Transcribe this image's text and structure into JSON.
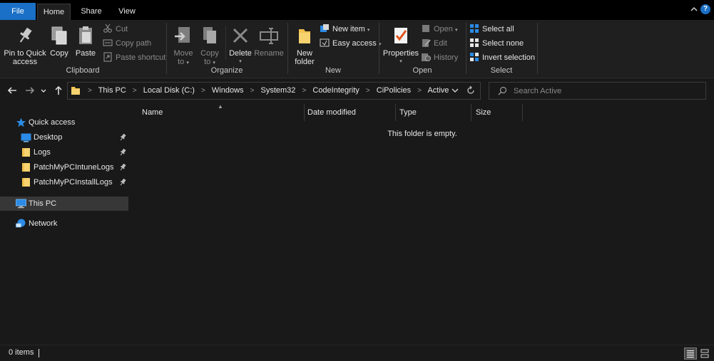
{
  "tabs": [
    {
      "label": "File"
    },
    {
      "label": "Home"
    },
    {
      "label": "Share"
    },
    {
      "label": "View"
    }
  ],
  "ribbon": {
    "clipboard": {
      "label": "Clipboard",
      "pin_line1": "Pin to Quick",
      "pin_line2": "access",
      "copy": "Copy",
      "paste": "Paste",
      "cut": "Cut",
      "copy_path": "Copy path",
      "paste_shortcut": "Paste shortcut"
    },
    "organize": {
      "label": "Organize",
      "move_line1": "Move",
      "move_line2": "to",
      "copy_line1": "Copy",
      "copy_line2": "to",
      "delete": "Delete",
      "rename": "Rename"
    },
    "new": {
      "label": "New",
      "folder_line1": "New",
      "folder_line2": "folder",
      "new_item": "New item",
      "easy_access": "Easy access"
    },
    "open": {
      "label": "Open",
      "properties": "Properties",
      "open": "Open",
      "edit": "Edit",
      "history": "History"
    },
    "select": {
      "label": "Select",
      "select_all": "Select all",
      "select_none": "Select none",
      "invert": "Invert selection"
    }
  },
  "address": {
    "crumbs": [
      "This PC",
      "Local Disk (C:)",
      "Windows",
      "System32",
      "CodeIntegrity",
      "CiPolicies",
      "Active"
    ]
  },
  "search": {
    "placeholder": "Search Active"
  },
  "nav": {
    "quick_access": "Quick access",
    "items": [
      {
        "label": "Desktop"
      },
      {
        "label": "Logs"
      },
      {
        "label": "PatchMyPCIntuneLogs"
      },
      {
        "label": "PatchMyPCInstallLogs"
      }
    ],
    "this_pc": "This PC",
    "network": "Network"
  },
  "columns": [
    "Name",
    "Date modified",
    "Type",
    "Size"
  ],
  "empty_message": "This folder is empty.",
  "status": {
    "count": "0 items"
  },
  "colors": {
    "file_tab": "#1a6fc6",
    "folder": "#f2c14e",
    "accent_blue": "#2b8be6"
  }
}
